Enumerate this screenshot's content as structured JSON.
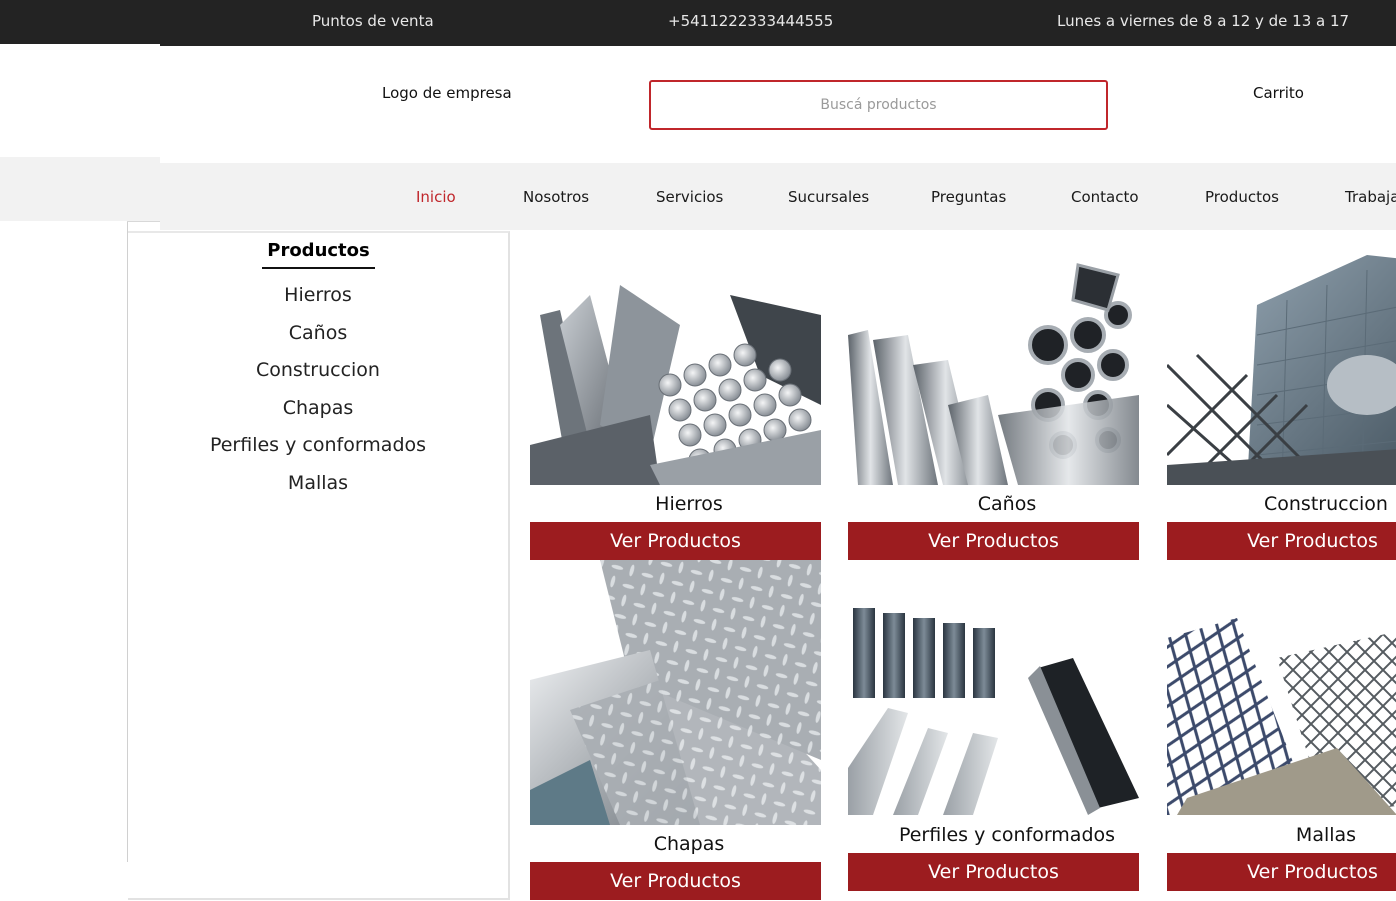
{
  "topbar": {
    "points_of_sale": "Puntos de venta",
    "phone": "+5411222333444555",
    "hours": "Lunes a viernes de 8 a 12 y de 13 a 17"
  },
  "header": {
    "logo": "Logo de empresa",
    "search_placeholder": "Buscá productos",
    "search_value": "",
    "cart": "Carrito"
  },
  "nav": {
    "items": [
      {
        "label": "Inicio",
        "active": true
      },
      {
        "label": "Nosotros"
      },
      {
        "label": "Servicios"
      },
      {
        "label": "Sucursales"
      },
      {
        "label": "Preguntas"
      },
      {
        "label": "Contacto"
      },
      {
        "label": "Productos"
      },
      {
        "label": "Trabaja"
      }
    ]
  },
  "sidebar": {
    "title": "Productos",
    "categories": [
      "Hierros",
      "Caños",
      "Construccion",
      "Chapas",
      "Perfiles y conformados",
      "Mallas"
    ]
  },
  "products": [
    {
      "title": "Hierros",
      "button": "Ver Productos",
      "image": "steel-bars-image"
    },
    {
      "title": "Caños",
      "button": "Ver Productos",
      "image": "steel-pipes-image"
    },
    {
      "title": "Construccion",
      "button": "Ver Productos",
      "image": "construction-steel-image"
    },
    {
      "title": "Chapas",
      "button": "Ver Productos",
      "image": "steel-sheets-image"
    },
    {
      "title": "Perfiles y conformados",
      "button": "Ver Productos",
      "image": "steel-profiles-image"
    },
    {
      "title": "Mallas",
      "button": "Ver Productos",
      "image": "steel-mesh-image"
    }
  ],
  "colors": {
    "topbar_bg": "#232323",
    "accent": "#c0262b",
    "button_bg": "#9c1c1f",
    "nav_bg": "#f2f2f2"
  }
}
